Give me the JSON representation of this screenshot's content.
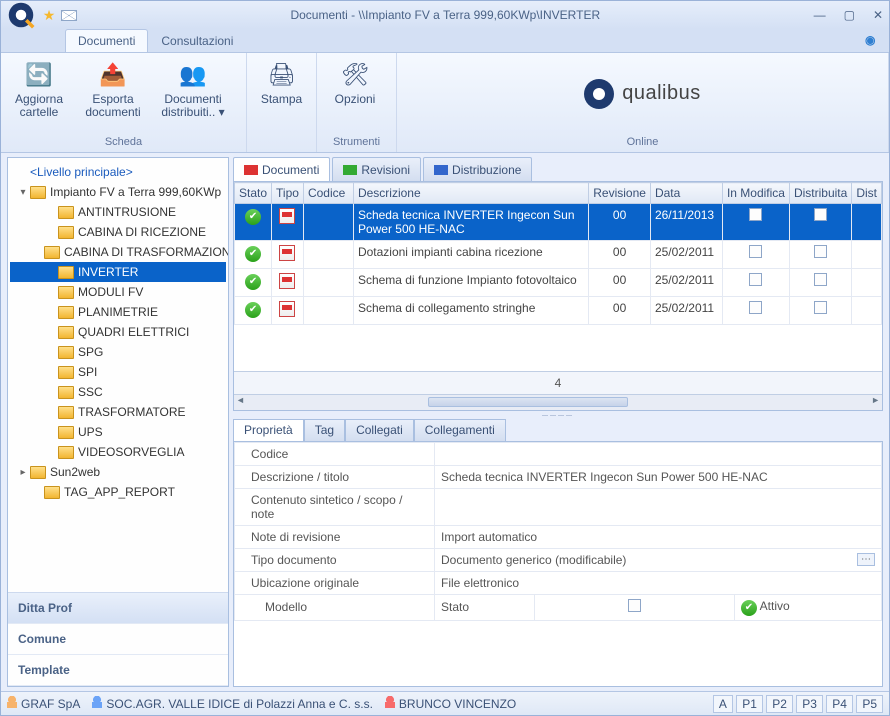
{
  "window": {
    "title": "Documenti - \\\\Impianto FV a Terra 999,60KWp\\INVERTER"
  },
  "mainTabs": {
    "documenti": "Documenti",
    "consultazioni": "Consultazioni"
  },
  "ribbon": {
    "scheda": {
      "aggiorna": "Aggiorna cartelle",
      "esporta": "Esporta documenti",
      "distribuiti": "Documenti distribuiti.. ▾",
      "label": "Scheda"
    },
    "stampa": {
      "btn": "Stampa",
      "label": ""
    },
    "strumenti": {
      "opzioni": "Opzioni",
      "label": "Strumenti"
    },
    "online": {
      "brand": "qualibus",
      "label": "Online"
    }
  },
  "tree": {
    "root": "<Livello principale>",
    "impianto": "Impianto FV a Terra 999,60KWp",
    "children": [
      "ANTINTRUSIONE",
      "CABINA DI RICEZIONE",
      "CABINA DI TRASFORMAZIONE",
      "INVERTER",
      "MODULI FV",
      "PLANIMETRIE",
      "QUADRI ELETTRICI",
      "SPG",
      "SPI",
      "SSC",
      "TRASFORMATORE",
      "UPS",
      "VIDEOSORVEGLIA"
    ],
    "sun2web": "Sun2web",
    "tagapp": "TAG_APP_REPORT"
  },
  "sidebarSections": {
    "ditta": "Ditta Prof",
    "comune": "Comune",
    "template": "Template"
  },
  "docTabs": {
    "documenti": "Documenti",
    "revisioni": "Revisioni",
    "distribuzione": "Distribuzione"
  },
  "grid": {
    "headers": {
      "stato": "Stato",
      "tipo": "Tipo",
      "codice": "Codice",
      "descrizione": "Descrizione",
      "revisione": "Revisione",
      "data": "Data",
      "inmod": "In Modifica",
      "distribuita": "Distribuita",
      "dist": "Dist"
    },
    "rows": [
      {
        "desc": "Scheda tecnica INVERTER Ingecon Sun Power 500 HE-NAC",
        "rev": "00",
        "data": "26/11/2013",
        "sel": true
      },
      {
        "desc": "Dotazioni impianti cabina ricezione",
        "rev": "00",
        "data": "25/02/2011",
        "sel": false
      },
      {
        "desc": "Schema di funzione Impianto fotovoltaico",
        "rev": "00",
        "data": "25/02/2011",
        "sel": false
      },
      {
        "desc": "Schema di collegamento stringhe",
        "rev": "00",
        "data": "25/02/2011",
        "sel": false
      }
    ],
    "count": "4"
  },
  "propTabs": {
    "proprieta": "Proprietà",
    "tag": "Tag",
    "collegati": "Collegati",
    "collegamenti": "Collegamenti"
  },
  "props": {
    "codice_l": "Codice",
    "codice_v": "",
    "desc_l": "Descrizione / titolo",
    "desc_v": "Scheda tecnica INVERTER Ingecon Sun Power 500 HE-NAC",
    "cont_l": "Contenuto sintetico / scopo / note",
    "cont_v": "",
    "note_l": "Note di revisione",
    "note_v": "Import automatico",
    "tipo_l": "Tipo documento",
    "tipo_v": "Documento generico (modificabile)",
    "ubi_l": "Ubicazione originale",
    "ubi_v": "File elettronico",
    "modello_l": "Modello",
    "stato_l": "Stato",
    "attivo": "Attivo"
  },
  "status": {
    "graf": "GRAF SpA",
    "soc": "SOC.AGR. VALLE IDICE di Polazzi Anna e C. s.s.",
    "brunco": "BRUNCO VINCENZO",
    "pages": [
      "A",
      "P1",
      "P2",
      "P3",
      "P4",
      "P5"
    ]
  }
}
